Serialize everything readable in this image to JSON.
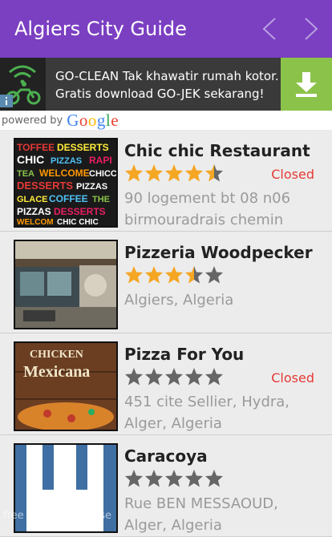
{
  "app": {
    "title": "Algiers City Guide"
  },
  "ad": {
    "text": "GO-CLEAN Tak khawatir rumah kotor. Gratis download GO-JEK sekarang!",
    "download_icon": "download-icon"
  },
  "powered": {
    "prefix": "powered by",
    "brand": "Google"
  },
  "colors": {
    "appbar": "#7b3fc2",
    "status_closed": "#e53935",
    "star_gold": "#f5a623",
    "star_grey": "#666666"
  },
  "places": [
    {
      "name": "Chic chic Restaurant",
      "rating": 4.5,
      "status": "Closed",
      "address": "90 logement bt 08 n06 birmouradrais chemin"
    },
    {
      "name": "Pizzeria Woodpecker",
      "rating": 3.5,
      "status": "",
      "address": "Algiers, Algeria"
    },
    {
      "name": "Pizza For You",
      "rating": 0,
      "status": "Closed",
      "address": "451 cite Sellier, Hydra, Alger, Algeria"
    },
    {
      "name": "Caracoya",
      "rating": 0,
      "status": "",
      "address": "Rue BEN MESSAOUD, Alger, Algeria"
    }
  ],
  "watermark": "free for personal use"
}
